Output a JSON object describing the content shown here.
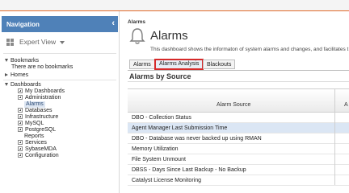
{
  "sidebar": {
    "header": "Navigation",
    "view_label": "Expert View",
    "bookmarks": {
      "label": "Bookmarks",
      "empty_text": "There are no bookmarks"
    },
    "homes": {
      "label": "Homes"
    },
    "dashboards": {
      "label": "Dashboards",
      "items": [
        "My Dashboards",
        "Administration",
        "Alarms",
        "Databases",
        "Infrastructure",
        "MySQL",
        "PostgreSQL",
        "Reports",
        "Services",
        "SybaseMDA",
        "Configuration"
      ]
    }
  },
  "main": {
    "breadcrumb": "Alarms",
    "title": "Alarms",
    "description": "This dashboard shows the informaton of system alarms and changes, and facilitates t",
    "tabs": [
      "Alarms",
      "Alarms Analysis",
      "Blackouts"
    ],
    "selected_tab": "Alarms Analysis",
    "section_title": "Alarms by Source",
    "table": {
      "columns": [
        "Alarm Source",
        "A"
      ],
      "rows": [
        "DBO - Collection Status",
        "Agent Manager Last Submission Time",
        "DBO - Database was never backed up using RMAN",
        "Memory Utilization",
        "File System Unmount",
        "DBSS - Days Since Last Backup - No Backup",
        "Catalyst License Monitoring"
      ],
      "highlighted_row": "Agent Manager Last Submission Time"
    }
  },
  "colors": {
    "nav_header": "#4f81b8",
    "accent_stripe": "#e06a2a",
    "selected_tab_outline": "#d62a2a",
    "highlight_row": "#dbe6f4"
  }
}
